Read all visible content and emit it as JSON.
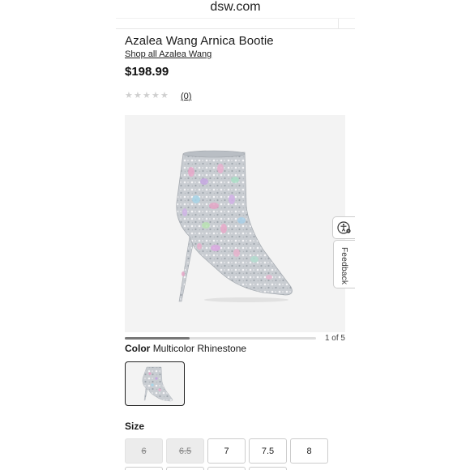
{
  "browser": {
    "url": "dsw.com"
  },
  "product": {
    "title": "Azalea Wang Arnica Bootie",
    "brand_link": "Shop all Azalea Wang",
    "price": "$198.99",
    "rating": {
      "stars": 0,
      "max": 5,
      "review_count": "(0)"
    }
  },
  "carousel": {
    "counter": "1 of 5",
    "progress": 0.34
  },
  "color": {
    "label": "Color",
    "value": "Multicolor Rhinestone"
  },
  "size": {
    "label": "Size",
    "options": [
      {
        "label": "6",
        "available": false
      },
      {
        "label": "6.5",
        "available": false
      },
      {
        "label": "7",
        "available": true
      },
      {
        "label": "7.5",
        "available": true
      },
      {
        "label": "8",
        "available": true
      }
    ]
  },
  "side_widgets": {
    "feedback": "Feedback",
    "accessibility_icon": "accessibility-icon"
  },
  "colors": {
    "price": "#111111",
    "star_empty": "#cfcfcf",
    "unavailable_bg": "#ececec"
  }
}
